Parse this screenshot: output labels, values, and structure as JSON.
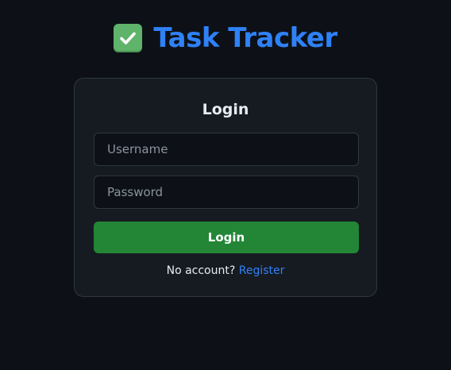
{
  "brand": {
    "icon": "check-box-icon",
    "title": "Task Tracker",
    "accent_color": "#2f81f7"
  },
  "login_form": {
    "title": "Login",
    "username_placeholder": "Username",
    "username_value": "",
    "password_placeholder": "Password",
    "password_value": "",
    "submit_label": "Login",
    "submit_color": "#238636",
    "no_account_text": "No account?",
    "register_link": "Register"
  }
}
